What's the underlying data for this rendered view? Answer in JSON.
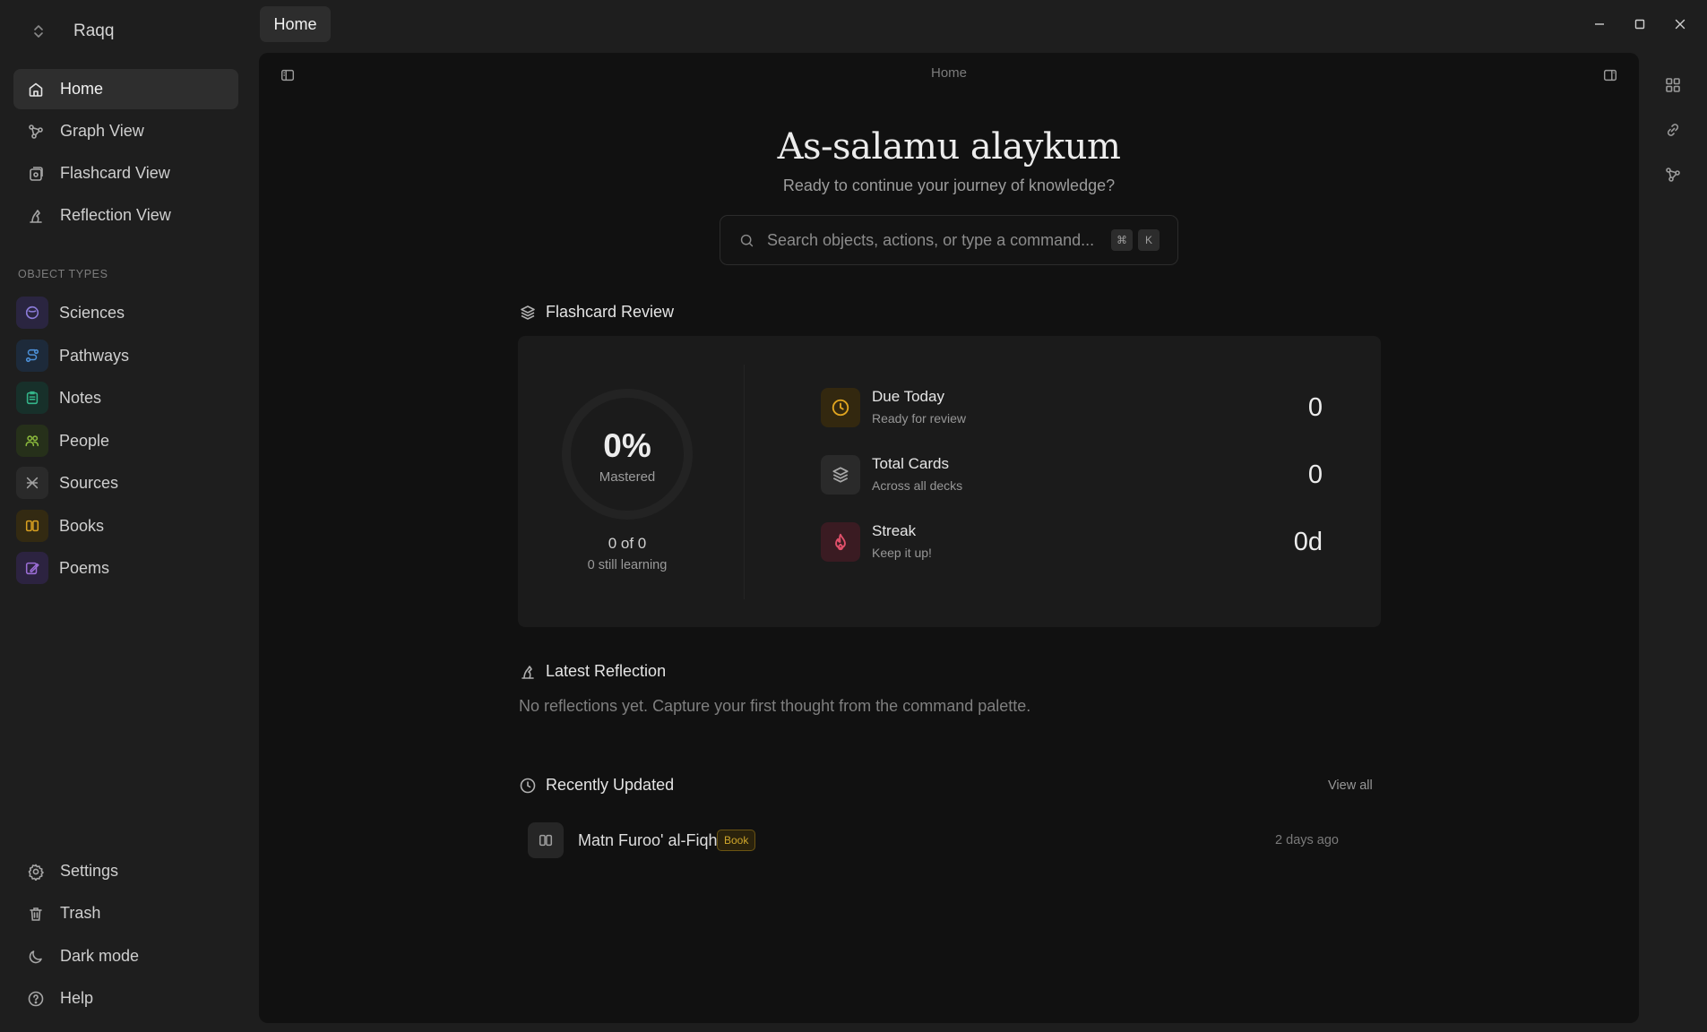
{
  "app": {
    "name": "Raqq"
  },
  "tab": {
    "label": "Home"
  },
  "sidebar": {
    "nav": [
      {
        "label": "Home",
        "icon": "home-icon",
        "active": true
      },
      {
        "label": "Graph View",
        "icon": "graph-icon"
      },
      {
        "label": "Flashcard View",
        "icon": "flashcard-icon"
      },
      {
        "label": "Reflection View",
        "icon": "reflection-icon"
      }
    ],
    "section_label": "OBJECT TYPES",
    "types": [
      {
        "label": "Sciences",
        "icon": "sciences-icon",
        "color": "#8b7bd8"
      },
      {
        "label": "Pathways",
        "icon": "pathways-icon",
        "color": "#4c8fd6"
      },
      {
        "label": "Notes",
        "icon": "notes-icon",
        "color": "#34b58a"
      },
      {
        "label": "People",
        "icon": "people-icon",
        "color": "#8ab83c"
      },
      {
        "label": "Sources",
        "icon": "sources-icon",
        "color": "#a0a0a0"
      },
      {
        "label": "Books",
        "icon": "books-icon",
        "color": "#d8a020"
      },
      {
        "label": "Poems",
        "icon": "poems-icon",
        "color": "#9b6ed6"
      }
    ],
    "bottom": [
      {
        "label": "Settings",
        "icon": "gear-icon"
      },
      {
        "label": "Trash",
        "icon": "trash-icon"
      },
      {
        "label": "Dark mode",
        "icon": "moon-icon"
      },
      {
        "label": "Help",
        "icon": "help-icon"
      }
    ]
  },
  "main": {
    "breadcrumb": "Home",
    "greeting": "As-salamu alaykum",
    "subtitle": "Ready to continue your journey of knowledge?",
    "search": {
      "placeholder": "Search objects, actions, or type a command...",
      "shortcut": [
        "⌘",
        "K"
      ]
    },
    "flashcard": {
      "title": "Flashcard Review",
      "mastered_percent": "0%",
      "mastered_label": "Mastered",
      "progress_fraction": 0,
      "count": "0 of 0",
      "learning": "0 still learning",
      "stats": [
        {
          "title": "Due Today",
          "sub": "Ready for review",
          "value": "0",
          "icon": "clock-icon",
          "color": "#e0a520"
        },
        {
          "title": "Total Cards",
          "sub": "Across all decks",
          "value": "0",
          "icon": "layers-icon",
          "color": "#a9a9a9"
        },
        {
          "title": "Streak",
          "sub": "Keep it up!",
          "value": "0d",
          "icon": "flame-icon",
          "color": "#e0506a"
        }
      ]
    },
    "reflection": {
      "title": "Latest Reflection",
      "empty": "No reflections yet. Capture your first thought from the command palette."
    },
    "recent": {
      "title": "Recently Updated",
      "view_all": "View all",
      "items": [
        {
          "title": "Matn Furoo' al-Fiqh",
          "badge": "Book",
          "time": "2 days ago"
        }
      ]
    }
  }
}
